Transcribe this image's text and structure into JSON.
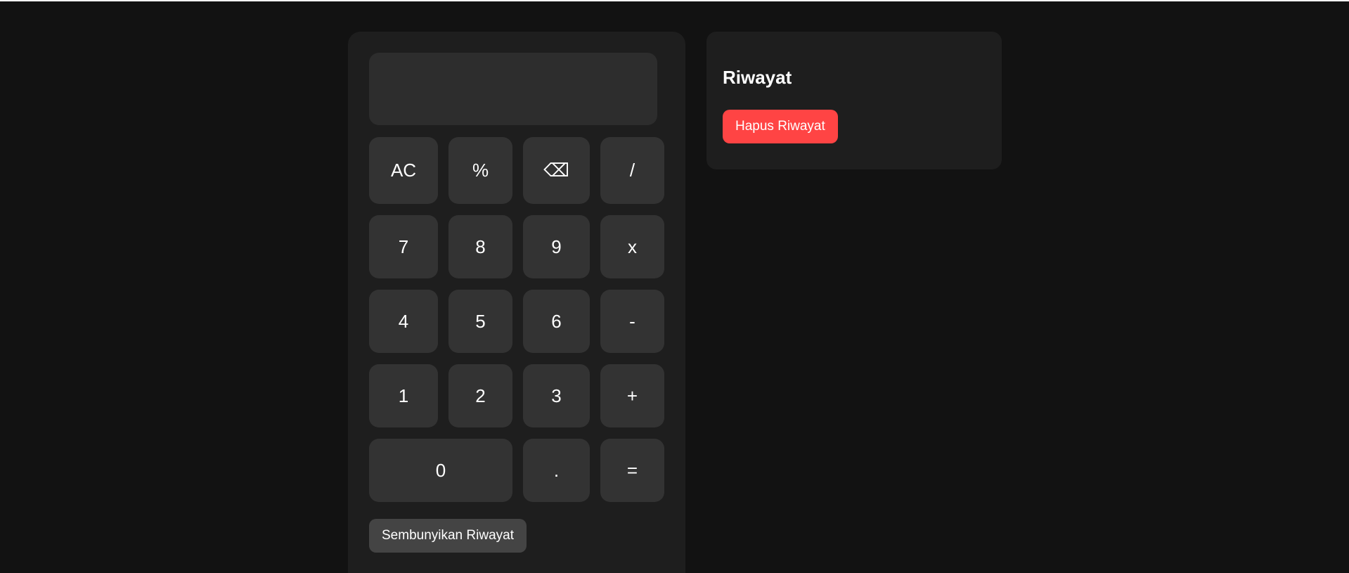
{
  "calculator": {
    "display_value": "",
    "keys": {
      "ac": "AC",
      "percent": "%",
      "backspace": "⌫",
      "divide": "/",
      "seven": "7",
      "eight": "8",
      "nine": "9",
      "multiply": "x",
      "four": "4",
      "five": "5",
      "six": "6",
      "minus": "-",
      "one": "1",
      "two": "2",
      "three": "3",
      "plus": "+",
      "zero": "0",
      "decimal": ".",
      "equals": "="
    },
    "toggle_history_label": "Sembunyikan Riwayat"
  },
  "history": {
    "title": "Riwayat",
    "clear_label": "Hapus Riwayat",
    "entries": []
  },
  "colors": {
    "background": "#121212",
    "panel": "#1e1e1e",
    "key": "#333333",
    "display": "#2d2d2d",
    "danger": "#ff4444",
    "secondary_button": "#444444"
  }
}
